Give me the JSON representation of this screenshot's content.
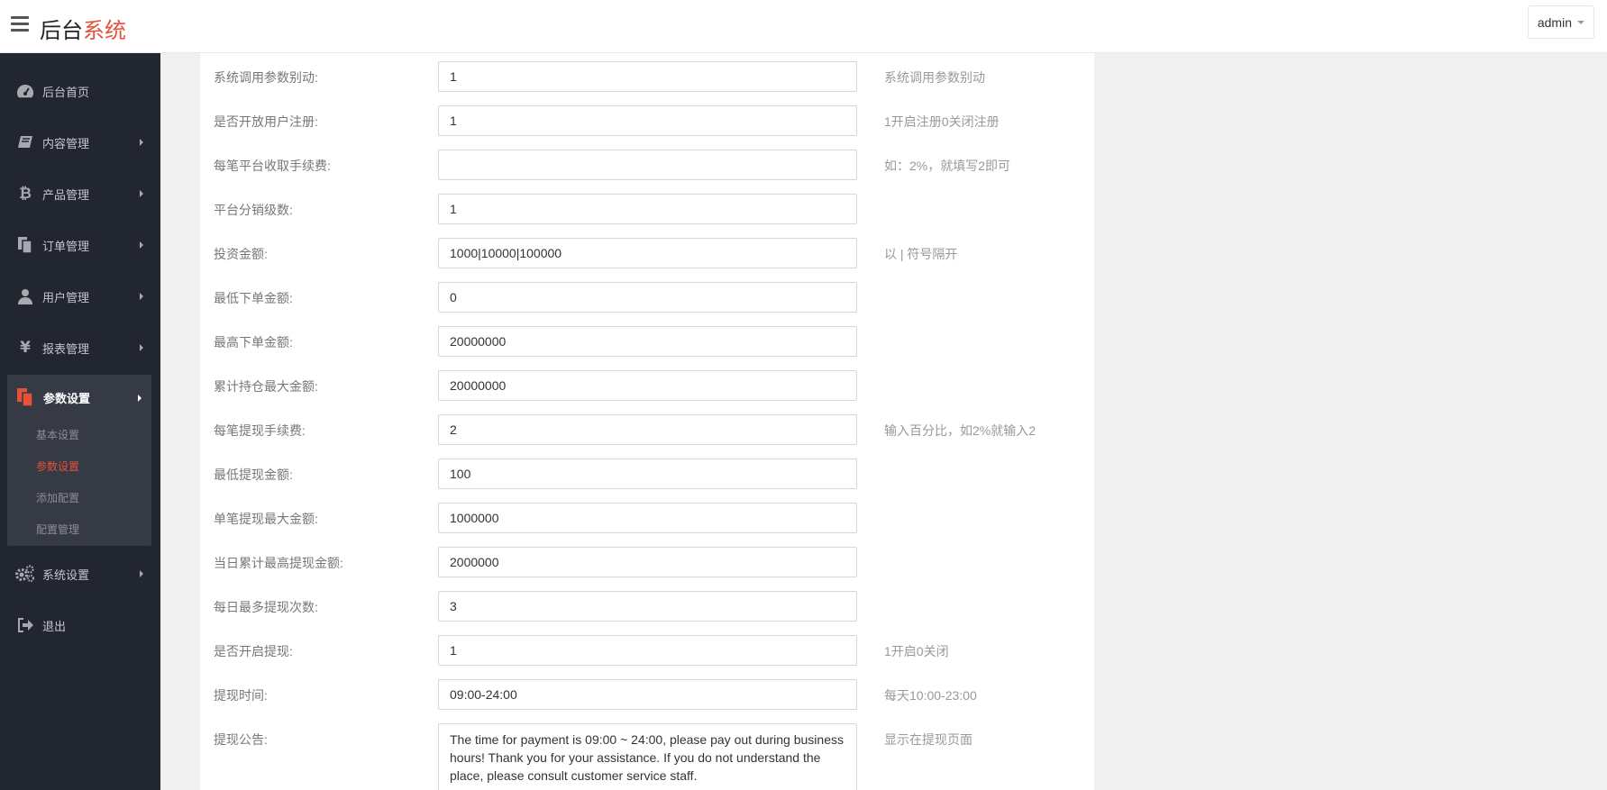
{
  "header": {
    "brand_part1": "后台",
    "brand_part2": "系统",
    "user_label": "admin"
  },
  "sidebar": {
    "items": [
      {
        "label": "后台首页",
        "icon": "dashboard-icon"
      },
      {
        "label": "内容管理",
        "icon": "book-icon"
      },
      {
        "label": "产品管理",
        "icon": "bitcoin-icon"
      },
      {
        "label": "订单管理",
        "icon": "copy-icon"
      },
      {
        "label": "用户管理",
        "icon": "user-icon"
      },
      {
        "label": "报表管理",
        "icon": "yen-icon"
      }
    ],
    "active_group": {
      "label": "参数设置",
      "icon": "copy-icon",
      "subitems": [
        "基本设置",
        "参数设置",
        "添加配置",
        "配置管理"
      ],
      "active_subitem": "参数设置"
    },
    "bottom_items": [
      {
        "label": "系统设置",
        "icon": "cogs-icon"
      },
      {
        "label": "退出",
        "icon": "sign-out-icon"
      }
    ]
  },
  "form": {
    "rows": [
      {
        "label": "系统调用参数别动:",
        "value": "1",
        "hint": "系统调用参数别动"
      },
      {
        "label": "是否开放用户注册:",
        "value": "1",
        "hint": "1开启注册0关闭注册"
      },
      {
        "label": "每笔平台收取手续费:",
        "value": "",
        "hint": "如：2%，就填写2即可"
      },
      {
        "label": "平台分销级数:",
        "value": "1",
        "hint": ""
      },
      {
        "label": "投资金额:",
        "value": "1000|10000|100000",
        "hint": "以 | 符号隔开"
      },
      {
        "label": "最低下单金额:",
        "value": "0",
        "hint": ""
      },
      {
        "label": "最高下单金额:",
        "value": "20000000",
        "hint": ""
      },
      {
        "label": "累计持仓最大金额:",
        "value": "20000000",
        "hint": ""
      },
      {
        "label": "每笔提现手续费:",
        "value": "2",
        "hint": "输入百分比，如2%就输入2"
      },
      {
        "label": "最低提现金额:",
        "value": "100",
        "hint": ""
      },
      {
        "label": "单笔提现最大金额:",
        "value": "1000000",
        "hint": ""
      },
      {
        "label": "当日累计最高提现金额:",
        "value": "2000000",
        "hint": ""
      },
      {
        "label": "每日最多提现次数:",
        "value": "3",
        "hint": ""
      },
      {
        "label": "是否开启提现:",
        "value": "1",
        "hint": "1开启0关闭"
      },
      {
        "label": "提现时间:",
        "value": "09:00-24:00",
        "hint": "每天10:00-23:00"
      }
    ],
    "notice": {
      "label": "提现公告:",
      "value": "The time for payment is 09:00 ~ 24:00, please pay out during business hours! Thank you for your assistance. If you do not understand the place, please consult customer service staff.",
      "hint": "显示在提现页面"
    }
  }
}
